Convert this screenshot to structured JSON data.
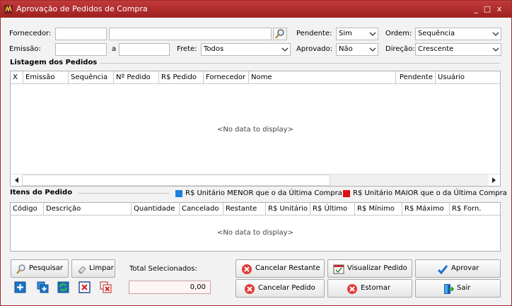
{
  "window": {
    "title": "Aprovação de Pedidos de Compra",
    "minimize_glyph": "_",
    "maximize_glyph": "□",
    "close_glyph": "x"
  },
  "filters": {
    "fornecedor_label": "Fornecedor:",
    "fornecedor_code": "",
    "fornecedor_name": "",
    "emissao_label": "Emissão:",
    "emissao_from": "",
    "emissao_sep": "a",
    "emissao_to": "",
    "frete_label": "Frete:",
    "frete_value": "Todos",
    "pendente_label": "Pendente:",
    "pendente_value": "Sim",
    "aprovado_label": "Aprovado:",
    "aprovado_value": "Não",
    "ordem_label": "Ordem:",
    "ordem_value": "Sequência",
    "direcao_label": "Direção:",
    "direcao_value": "Crescente"
  },
  "orders": {
    "section_title": "Listagem dos Pedidos",
    "columns": [
      "X",
      "Emissão",
      "Sequência",
      "Nº Pedido",
      "R$ Pedido",
      "Fornecedor",
      "Nome",
      "Pendente",
      "Usuário"
    ],
    "empty_text": "<No data to display>"
  },
  "items": {
    "section_title": "Itens do Pedido",
    "legend_lower": "R$ Unitário MENOR que o da Última Compra",
    "legend_higher": "R$ Unitário MAIOR que o da Última Compra",
    "legend_lower_color": "#1e7fe0",
    "legend_higher_color": "#e01010",
    "columns": [
      "Código",
      "Descrição",
      "Quantidade",
      "Cancelado",
      "Restante",
      "R$ Unitário",
      "R$ Último",
      "R$ Mínimo",
      "R$ Máximo",
      "R$ Forn."
    ],
    "empty_text": "<No data to display>"
  },
  "footer": {
    "pesquisar": "Pesquisar",
    "limpar": "Limpar",
    "total_label": "Total Selecionados:",
    "total_value": "0,00",
    "cancelar_restante": "Cancelar Restante",
    "visualizar_pedido": "Visualizar Pedido",
    "aprovar": "Aprovar",
    "cancelar_pedido": "Cancelar Pedido",
    "estornar": "Estornar",
    "sair": "Sair"
  },
  "colors": {
    "titlebar": "#b02a2a",
    "accent_red": "#d82020"
  }
}
